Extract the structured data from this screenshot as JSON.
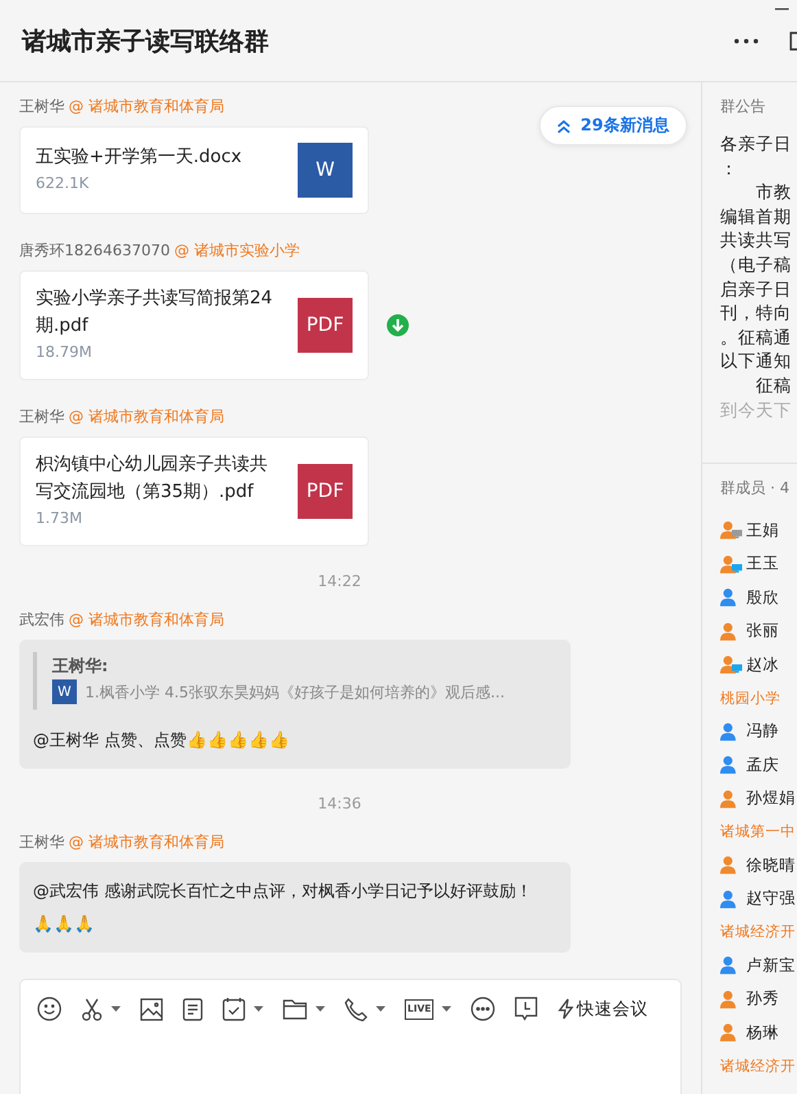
{
  "window": {
    "title": "诸城市亲子读写联络群"
  },
  "new_messages": {
    "label": "29条新消息"
  },
  "messages": [
    {
      "kind": "file",
      "sender": "王树华",
      "org": "@ 诸城市教育和体育局",
      "file_name": "五实验+开学第一天.docx",
      "file_size": "622.1K",
      "color": "#2c5ba6",
      "icon_label": "W",
      "downloaded": false
    },
    {
      "kind": "file",
      "sender": "唐秀环18264637070",
      "org": "@ 诸城市实验小学",
      "file_name": "实验小学亲子共读写简报第24期.pdf",
      "file_size": "18.79M",
      "color": "#c1344a",
      "icon_label": "PDF",
      "downloaded": true
    },
    {
      "kind": "file",
      "sender": "王树华",
      "org": "@ 诸城市教育和体育局",
      "file_name": "枳沟镇中心幼儿园亲子共读共写交流园地（第35期）.pdf",
      "file_size": "1.73M",
      "color": "#c1344a",
      "icon_label": "PDF",
      "downloaded": false
    },
    {
      "kind": "time",
      "text": "14:22"
    },
    {
      "kind": "quote",
      "sender": "武宏伟",
      "org": "@ 诸城市教育和体育局",
      "quote_author": "王树华:",
      "quote_icon_label": "W",
      "quote_text": "1.枫香小学 4.5张驭东昊妈妈《好孩子是如何培养的》观后感...",
      "text": "@王树华  点赞、点赞👍👍👍👍👍"
    },
    {
      "kind": "time",
      "text": "14:36"
    },
    {
      "kind": "text",
      "sender": "王树华",
      "org": "@ 诸城市教育和体育局",
      "text": "@武宏伟 感谢武院长百忙之中点评，对枫香小学日记予以好评鼓励！🙏🙏🙏"
    }
  ],
  "toolbar": [
    {
      "kind": "emoji",
      "menu": false
    },
    {
      "kind": "scissors",
      "menu": true
    },
    {
      "kind": "image",
      "menu": false
    },
    {
      "kind": "document",
      "menu": false
    },
    {
      "kind": "calendar",
      "menu": true
    },
    {
      "kind": "folder",
      "menu": true
    },
    {
      "kind": "phone",
      "menu": true
    },
    {
      "kind": "live",
      "menu": true,
      "label": "LIVE"
    },
    {
      "kind": "more",
      "menu": false
    },
    {
      "kind": "clock",
      "menu": false
    },
    {
      "kind": "meeting",
      "menu": false,
      "label": "快速会议"
    }
  ],
  "announcement": {
    "title": "群公告",
    "lines": [
      "各亲子日",
      "：",
      "　　市教",
      "编辑首期",
      "共读共写",
      "（电子稿",
      "启亲子日",
      "刊，特向",
      "。征稿通",
      "以下通知",
      "　　征稿",
      "到今天下"
    ]
  },
  "members": {
    "title": "群成员 · 4",
    "entries": [
      {
        "kind": "member",
        "name": "王娟",
        "color": "#f0892e",
        "on_pc": true,
        "pc_active": false
      },
      {
        "kind": "member",
        "name": "王玉",
        "color": "#f0892e",
        "on_pc": true,
        "pc_active": true
      },
      {
        "kind": "member",
        "name": "殷欣",
        "color": "#2f8cf0",
        "on_pc": false
      },
      {
        "kind": "member",
        "name": "张丽",
        "color": "#f0892e",
        "on_pc": false
      },
      {
        "kind": "member",
        "name": "赵冰",
        "color": "#f0892e",
        "on_pc": true,
        "pc_active": true
      },
      {
        "kind": "group",
        "name": "桃园小学"
      },
      {
        "kind": "member",
        "name": "冯静",
        "color": "#2f8cf0",
        "on_pc": false
      },
      {
        "kind": "member",
        "name": "孟庆",
        "color": "#2f8cf0",
        "on_pc": false
      },
      {
        "kind": "member",
        "name": "孙煜娟",
        "color": "#f0892e",
        "on_pc": false
      },
      {
        "kind": "group",
        "name": "诸城第一中"
      },
      {
        "kind": "member",
        "name": "徐晓晴",
        "color": "#f0892e",
        "on_pc": false
      },
      {
        "kind": "member",
        "name": "赵守强",
        "color": "#2f8cf0",
        "on_pc": false
      },
      {
        "kind": "group",
        "name": "诸城经济开"
      },
      {
        "kind": "member",
        "name": "卢新宝",
        "color": "#2f8cf0",
        "on_pc": false
      },
      {
        "kind": "member",
        "name": "孙秀",
        "color": "#f0892e",
        "on_pc": false
      },
      {
        "kind": "member",
        "name": "杨琳",
        "color": "#f0892e",
        "on_pc": false
      },
      {
        "kind": "group",
        "name": "诸城经济开"
      }
    ]
  }
}
